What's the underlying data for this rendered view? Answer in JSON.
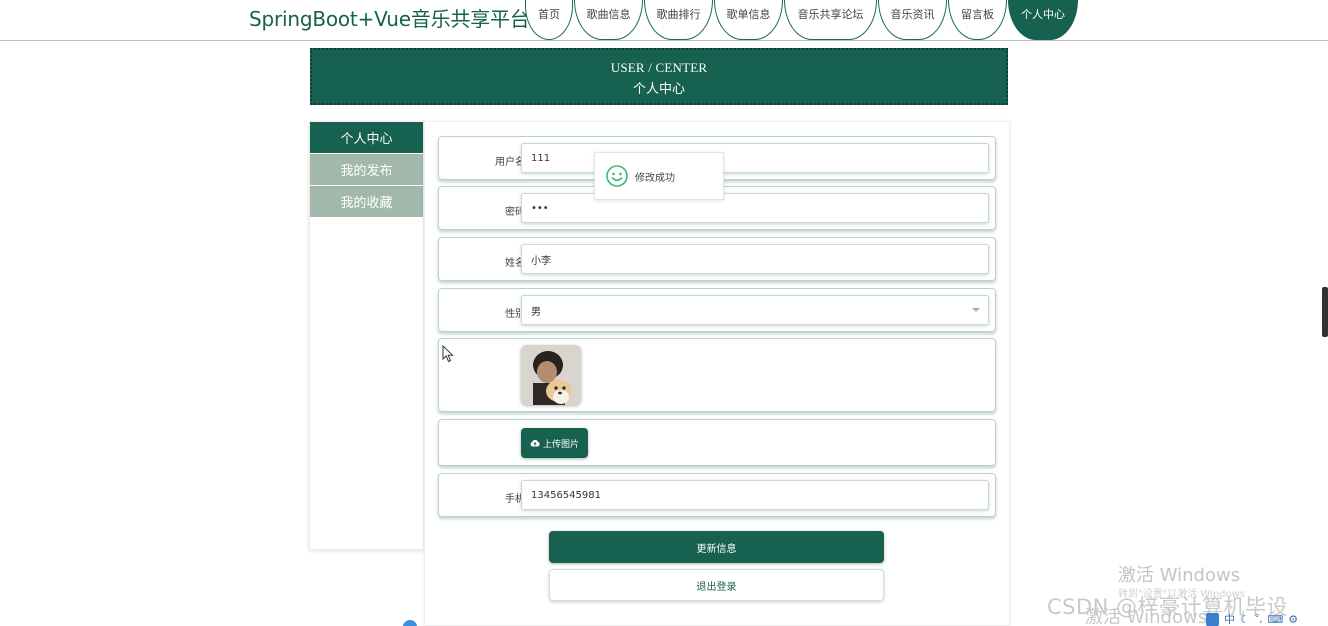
{
  "app": {
    "title": "SpringBoot+Vue音乐共享平台"
  },
  "nav": {
    "tabs": [
      {
        "label": "首页",
        "active": false
      },
      {
        "label": "歌曲信息",
        "active": false
      },
      {
        "label": "歌曲排行",
        "active": false
      },
      {
        "label": "歌单信息",
        "active": false
      },
      {
        "label": "音乐共享论坛",
        "active": false
      },
      {
        "label": "音乐资讯",
        "active": false
      },
      {
        "label": "留言板",
        "active": false
      },
      {
        "label": "个人中心",
        "active": true
      }
    ]
  },
  "banner": {
    "title_en": "USER / CENTER",
    "title_cn": "个人中心"
  },
  "sidebar": {
    "items": [
      {
        "label": "个人中心",
        "active": true
      },
      {
        "label": "我的发布",
        "active": false
      },
      {
        "label": "我的收藏",
        "active": false
      }
    ]
  },
  "form": {
    "username": {
      "label": "用户名",
      "value": "111"
    },
    "password": {
      "label": "密码",
      "value": "•••"
    },
    "name": {
      "label": "姓名",
      "value": "小李"
    },
    "gender": {
      "label": "性别",
      "value": "男"
    },
    "upload_label": "上传图片",
    "phone": {
      "label": "手机",
      "value": "13456545981"
    },
    "update_button": "更新信息",
    "logout_button": "退出登录"
  },
  "toast": {
    "message": "修改成功"
  },
  "watermark": {
    "activate_title": "激活 Windows",
    "activate_sub": "转到\"设置\"以激活 Windows",
    "csdn": "CSDN @梓豪计算机毕设",
    "ghost": "激活 Windows"
  },
  "tray": {
    "ime": "中"
  },
  "colors": {
    "primary": "#16614f",
    "sidebar_inactive": "#a2b8aa",
    "field_border": "#c7d9d1"
  }
}
